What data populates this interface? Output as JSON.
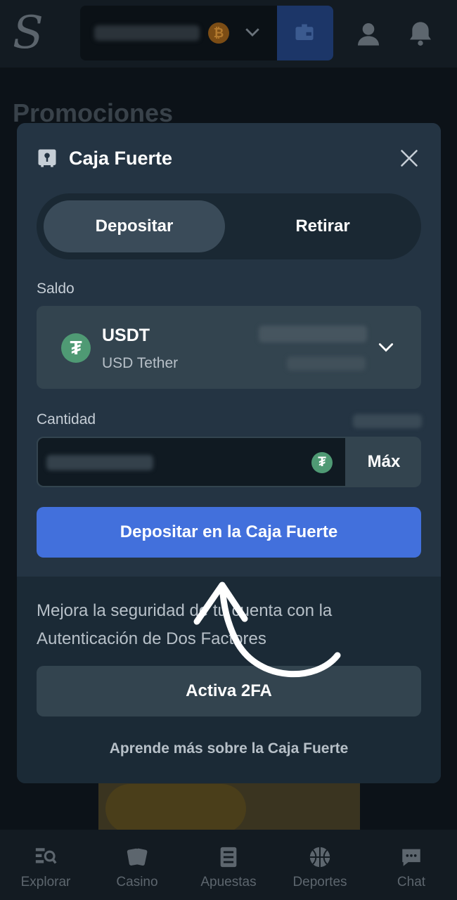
{
  "header": {
    "logo_letter": "S",
    "currency_icon": "bitcoin-icon",
    "icons": [
      "wallet-icon",
      "user-icon",
      "bell-icon"
    ]
  },
  "background": {
    "page_title": "Promociones"
  },
  "modal": {
    "title": "Caja Fuerte",
    "tabs": [
      {
        "label": "Depositar",
        "active": true
      },
      {
        "label": "Retirar",
        "active": false
      }
    ],
    "balance_label": "Saldo",
    "currency": {
      "code": "USDT",
      "name": "USD Tether",
      "icon_glyph": "₮"
    },
    "amount_label": "Cantidad",
    "max_label": "Máx",
    "deposit_button": "Depositar en la Caja Fuerte",
    "twofa_text": "Mejora la seguridad de tu cuenta con la Autenticación de Dos Factores",
    "twofa_button": "Activa 2FA",
    "learn_more": "Aprende más sobre la Caja Fuerte"
  },
  "bottom_nav": {
    "items": [
      {
        "label": "Explorar",
        "icon": "explore-icon"
      },
      {
        "label": "Casino",
        "icon": "cards-icon"
      },
      {
        "label": "Apuestas",
        "icon": "bets-icon"
      },
      {
        "label": "Deportes",
        "icon": "basketball-icon"
      },
      {
        "label": "Chat",
        "icon": "chat-icon"
      }
    ]
  },
  "colors": {
    "accent": "#4270dc",
    "modal_bg": "#243443",
    "usdt_green": "#4f9a74"
  }
}
